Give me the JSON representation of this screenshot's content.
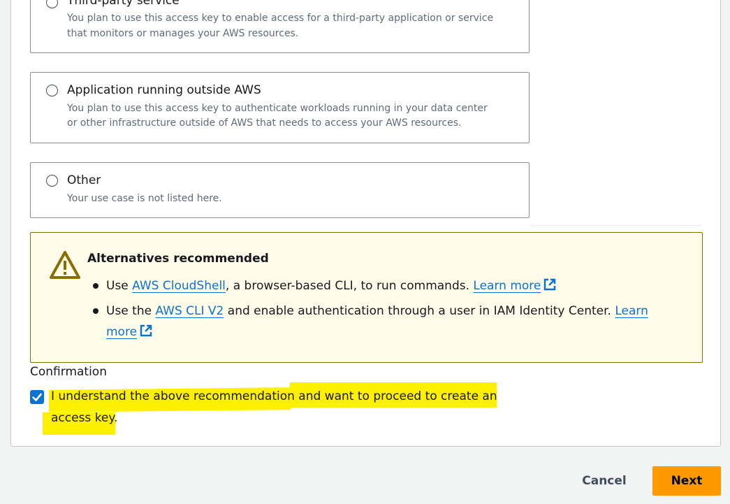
{
  "options": [
    {
      "title": "Third-party service",
      "desc1": "You plan to use this access key to enable access for a third-party application or service",
      "desc2": "that monitors or manages your AWS resources."
    },
    {
      "title": "Application running outside AWS",
      "desc1": "You plan to use this access key to authenticate workloads running in your data center",
      "desc2": "or other infrastructure outside of AWS that needs to access your AWS resources."
    },
    {
      "title": "Other",
      "desc1": "Your use case is not listed here."
    }
  ],
  "alert": {
    "title": "Alternatives recommended",
    "item1": {
      "prefix": "Use ",
      "link": "AWS CloudShell",
      "middle": ", a browser-based CLI, to run commands. ",
      "learn_more": "Learn more"
    },
    "item2": {
      "prefix": "Use the ",
      "link": "AWS CLI V2",
      "middle": " and enable authentication through a user in IAM Identity Center. ",
      "learn_more_a": "Learn",
      "learn_more_b": "more"
    }
  },
  "confirmation": {
    "label": "Confirmation",
    "checked": true,
    "text_line1": "I understand the above recommendation and want to proceed to create an",
    "text_line2": "access key."
  },
  "footer": {
    "cancel": "Cancel",
    "next": "Next"
  },
  "colors": {
    "link": "#0972d3",
    "primary_button": "#ff9900",
    "alert_background": "#fffce9",
    "alert_border": "#8a6d00",
    "highlight": "#fff000"
  },
  "icons": [
    "warning-icon",
    "external-link-icon",
    "check-icon"
  ]
}
